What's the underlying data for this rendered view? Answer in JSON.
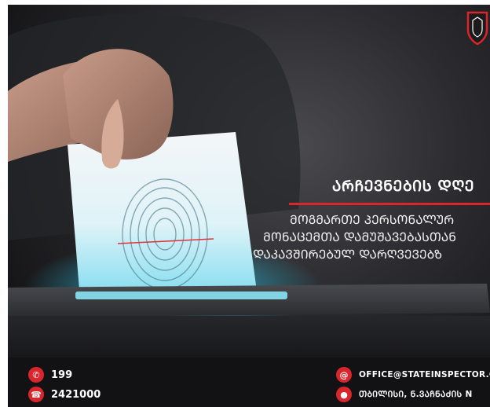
{
  "headline": "ᲐᲠᲩᲔᲕᲜᲔᲑᲘᲡ ᲓᲦᲔ",
  "subtitle": {
    "line1": "ᲛᲝᲒᲛᲐᲠᲗᲔ ᲞᲔᲠᲡᲝᲜᲐᲚᲣᲠ",
    "line2": "ᲛᲝᲜᲐᲪᲔᲛᲗᲐ ᲓᲐᲛᲣᲨᲐᲕᲔᲑᲐᲡᲗᲐᲜ",
    "line3": "ᲓᲐᲙᲐᲕᲨᲘᲠᲔᲑᲣᲚ ᲓᲐᲠᲦᲕᲔᲕᲔᲑᲖ"
  },
  "contacts": {
    "phone": "199",
    "phone2": "2421000",
    "email": "OFFICE@STATEINSPECTOR.G",
    "address": "ᲗᲑᲘᲚᲘᲡᲘ, Ნ.ᲕᲐᲩᲜᲐᲫᲘᲡ N"
  },
  "icons": {
    "phone": "phone-icon",
    "fax": "fax-icon",
    "email": "at-icon",
    "address": "location-pin-icon",
    "logo": "shield-logo"
  },
  "colors": {
    "accent": "#d8262c",
    "glow": "#33d6f0",
    "background": "#1a1a1c"
  }
}
